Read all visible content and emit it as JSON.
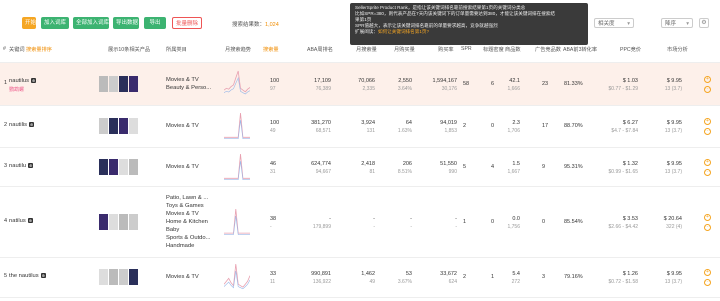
{
  "toolbar": {
    "buttons": [
      "开始",
      "加入词库",
      "全部加入词库",
      "导出数据",
      "导出",
      "批量删除"
    ],
    "count_label": "搜索结果数：",
    "count_value": "1,024",
    "selects": [
      "相关度",
      "降序"
    ]
  },
  "tooltip": {
    "line1": "SellerSprite Product Rank，是指让该关键词排名靠前搜索结果第1页的关键词分类总",
    "line2": "比如SPR=380，则代表产品在7天内该关键词下的订单量需要达到380，才能让该关键词排在搜索结",
    "line3": "果第1页",
    "line4": "SPR值越大，表示让该关键词排名靠前的单量要求越高，竞争就越强烈",
    "line5_label": "扩展阅读：",
    "line5_link": "如何让关键词排名第1页?"
  },
  "headers": {
    "num": "#",
    "keyword": "关键词",
    "keyword_sub": "搜索量排序",
    "products": "展示10条相关产品",
    "category": "所属类目",
    "trend": "月搜索趋势",
    "monthly_search": "搜索量",
    "aba_rank": "ABA周排名",
    "aba_rank_sub": "",
    "monthly": "月搜索量",
    "daily": "月购买量",
    "purchase": "购买率",
    "spr": "SPR",
    "title_density": "标题密度",
    "products_count": "商品数",
    "supply_demand": "供需比",
    "click_share": "点击集中度",
    "ads": "广告竞品数",
    "aba_share": "ABA前3转化率",
    "ppc": "PPC竞价",
    "market": "市场分析"
  },
  "rows": [
    {
      "index": "1",
      "keyword": "nautilus",
      "keyword_sub": "鹦鹉螺",
      "categories": [
        "Movies & TV",
        "Beauty & Perso..."
      ],
      "rank": "100",
      "rank_sub": "97",
      "aba": "17,109",
      "aba_sub": "76,389",
      "monthly": "70,066",
      "monthly_sub": "2,335",
      "daily": "2,550",
      "daily_sub": "3.64%",
      "purchase": "1,594,167",
      "purchase_sub": "30,176",
      "spr": "58",
      "title": "6",
      "supply": "42.1",
      "supply_sub": "1,666",
      "ads": "23",
      "aba_share": "81.33%",
      "ppc": "$ 1.03",
      "ppc_sub": "$0.77 - $1.29",
      "price": "$ 9.95",
      "price_sub": "13 (3.7)",
      "trend": [
        8,
        10,
        9,
        12,
        14,
        22,
        30,
        10,
        8,
        6,
        9,
        11
      ]
    },
    {
      "index": "2",
      "keyword": "nautilis",
      "keyword_sub": "",
      "categories": [
        "Movies & TV"
      ],
      "rank": "100",
      "rank_sub": "49",
      "aba": "381,270",
      "aba_sub": "68,571",
      "monthly": "3,924",
      "monthly_sub": "131",
      "daily": "64",
      "daily_sub": "1.63%",
      "purchase": "94,019",
      "purchase_sub": "1,853",
      "spr": "2",
      "title": "0",
      "supply": "2.3",
      "supply_sub": "1,706",
      "ads": "17",
      "aba_share": "88.70%",
      "ppc": "$ 6.27",
      "ppc_sub": "$4.7 - $7.84",
      "price": "$ 9.95",
      "price_sub": "13 (3.7)",
      "trend": [
        2,
        2,
        2,
        2,
        2,
        2,
        2,
        30,
        2,
        2,
        2,
        2
      ]
    },
    {
      "index": "3",
      "keyword": "nautilu",
      "keyword_sub": "",
      "categories": [
        "Movies & TV"
      ],
      "rank": "46",
      "rank_sub": "31",
      "aba": "624,774",
      "aba_sub": "94,667",
      "monthly": "2,418",
      "monthly_sub": "81",
      "daily": "206",
      "daily_sub": "8.51%",
      "purchase": "51,550",
      "purchase_sub": "990",
      "spr": "5",
      "title": "4",
      "supply": "1.5",
      "supply_sub": "1,667",
      "ads": "9",
      "aba_share": "95.31%",
      "ppc": "$ 1.32",
      "ppc_sub": "$0.99 - $1.65",
      "price": "$ 9.95",
      "price_sub": "13 (3.7)",
      "trend": [
        2,
        2,
        2,
        2,
        2,
        2,
        2,
        30,
        2,
        2,
        2,
        2
      ]
    },
    {
      "index": "4",
      "keyword": "natilus",
      "keyword_sub": "",
      "categories": [
        "Patio, Lawn & ...",
        "Toys & Games",
        "Movies & TV",
        "Home & Kitchen",
        "Baby",
        "Sports & Outdo...",
        "Handmade"
      ],
      "rank": "38",
      "rank_sub": "-",
      "aba": "-",
      "aba_sub": "179,899",
      "monthly": "-",
      "monthly_sub": "-",
      "daily": "-",
      "daily_sub": "-",
      "purchase": "-",
      "purchase_sub": "-",
      "spr": "1",
      "title": "0",
      "supply": "0.0",
      "supply_sub": "1,756",
      "ads": "0",
      "aba_share": "85.54%",
      "ppc": "$ 3.53",
      "ppc_sub": "$2.66 - $4.42",
      "price": "$ 20.64",
      "price_sub": "322 (4)",
      "trend": [
        2,
        2,
        2,
        2,
        2,
        28,
        2,
        2,
        2,
        2,
        2,
        2
      ]
    },
    {
      "index": "5",
      "keyword": "the nautilus",
      "keyword_sub": "",
      "categories": [
        "Movies & TV"
      ],
      "rank": "33",
      "rank_sub": "11",
      "aba": "990,891",
      "aba_sub": "136,922",
      "monthly": "1,462",
      "monthly_sub": "49",
      "daily": "53",
      "daily_sub": "3.67%",
      "purchase": "33,672",
      "purchase_sub": "624",
      "spr": "2",
      "title": "1",
      "supply": "5.4",
      "supply_sub": "272",
      "ads": "3",
      "aba_share": "79.16%",
      "ppc": "$ 1.26",
      "ppc_sub": "$0.72 - $1.58",
      "price": "$ 9.95",
      "price_sub": "13 (3.7)",
      "trend": [
        4,
        6,
        8,
        5,
        3,
        18,
        4,
        3,
        2,
        4,
        6,
        10
      ]
    }
  ]
}
